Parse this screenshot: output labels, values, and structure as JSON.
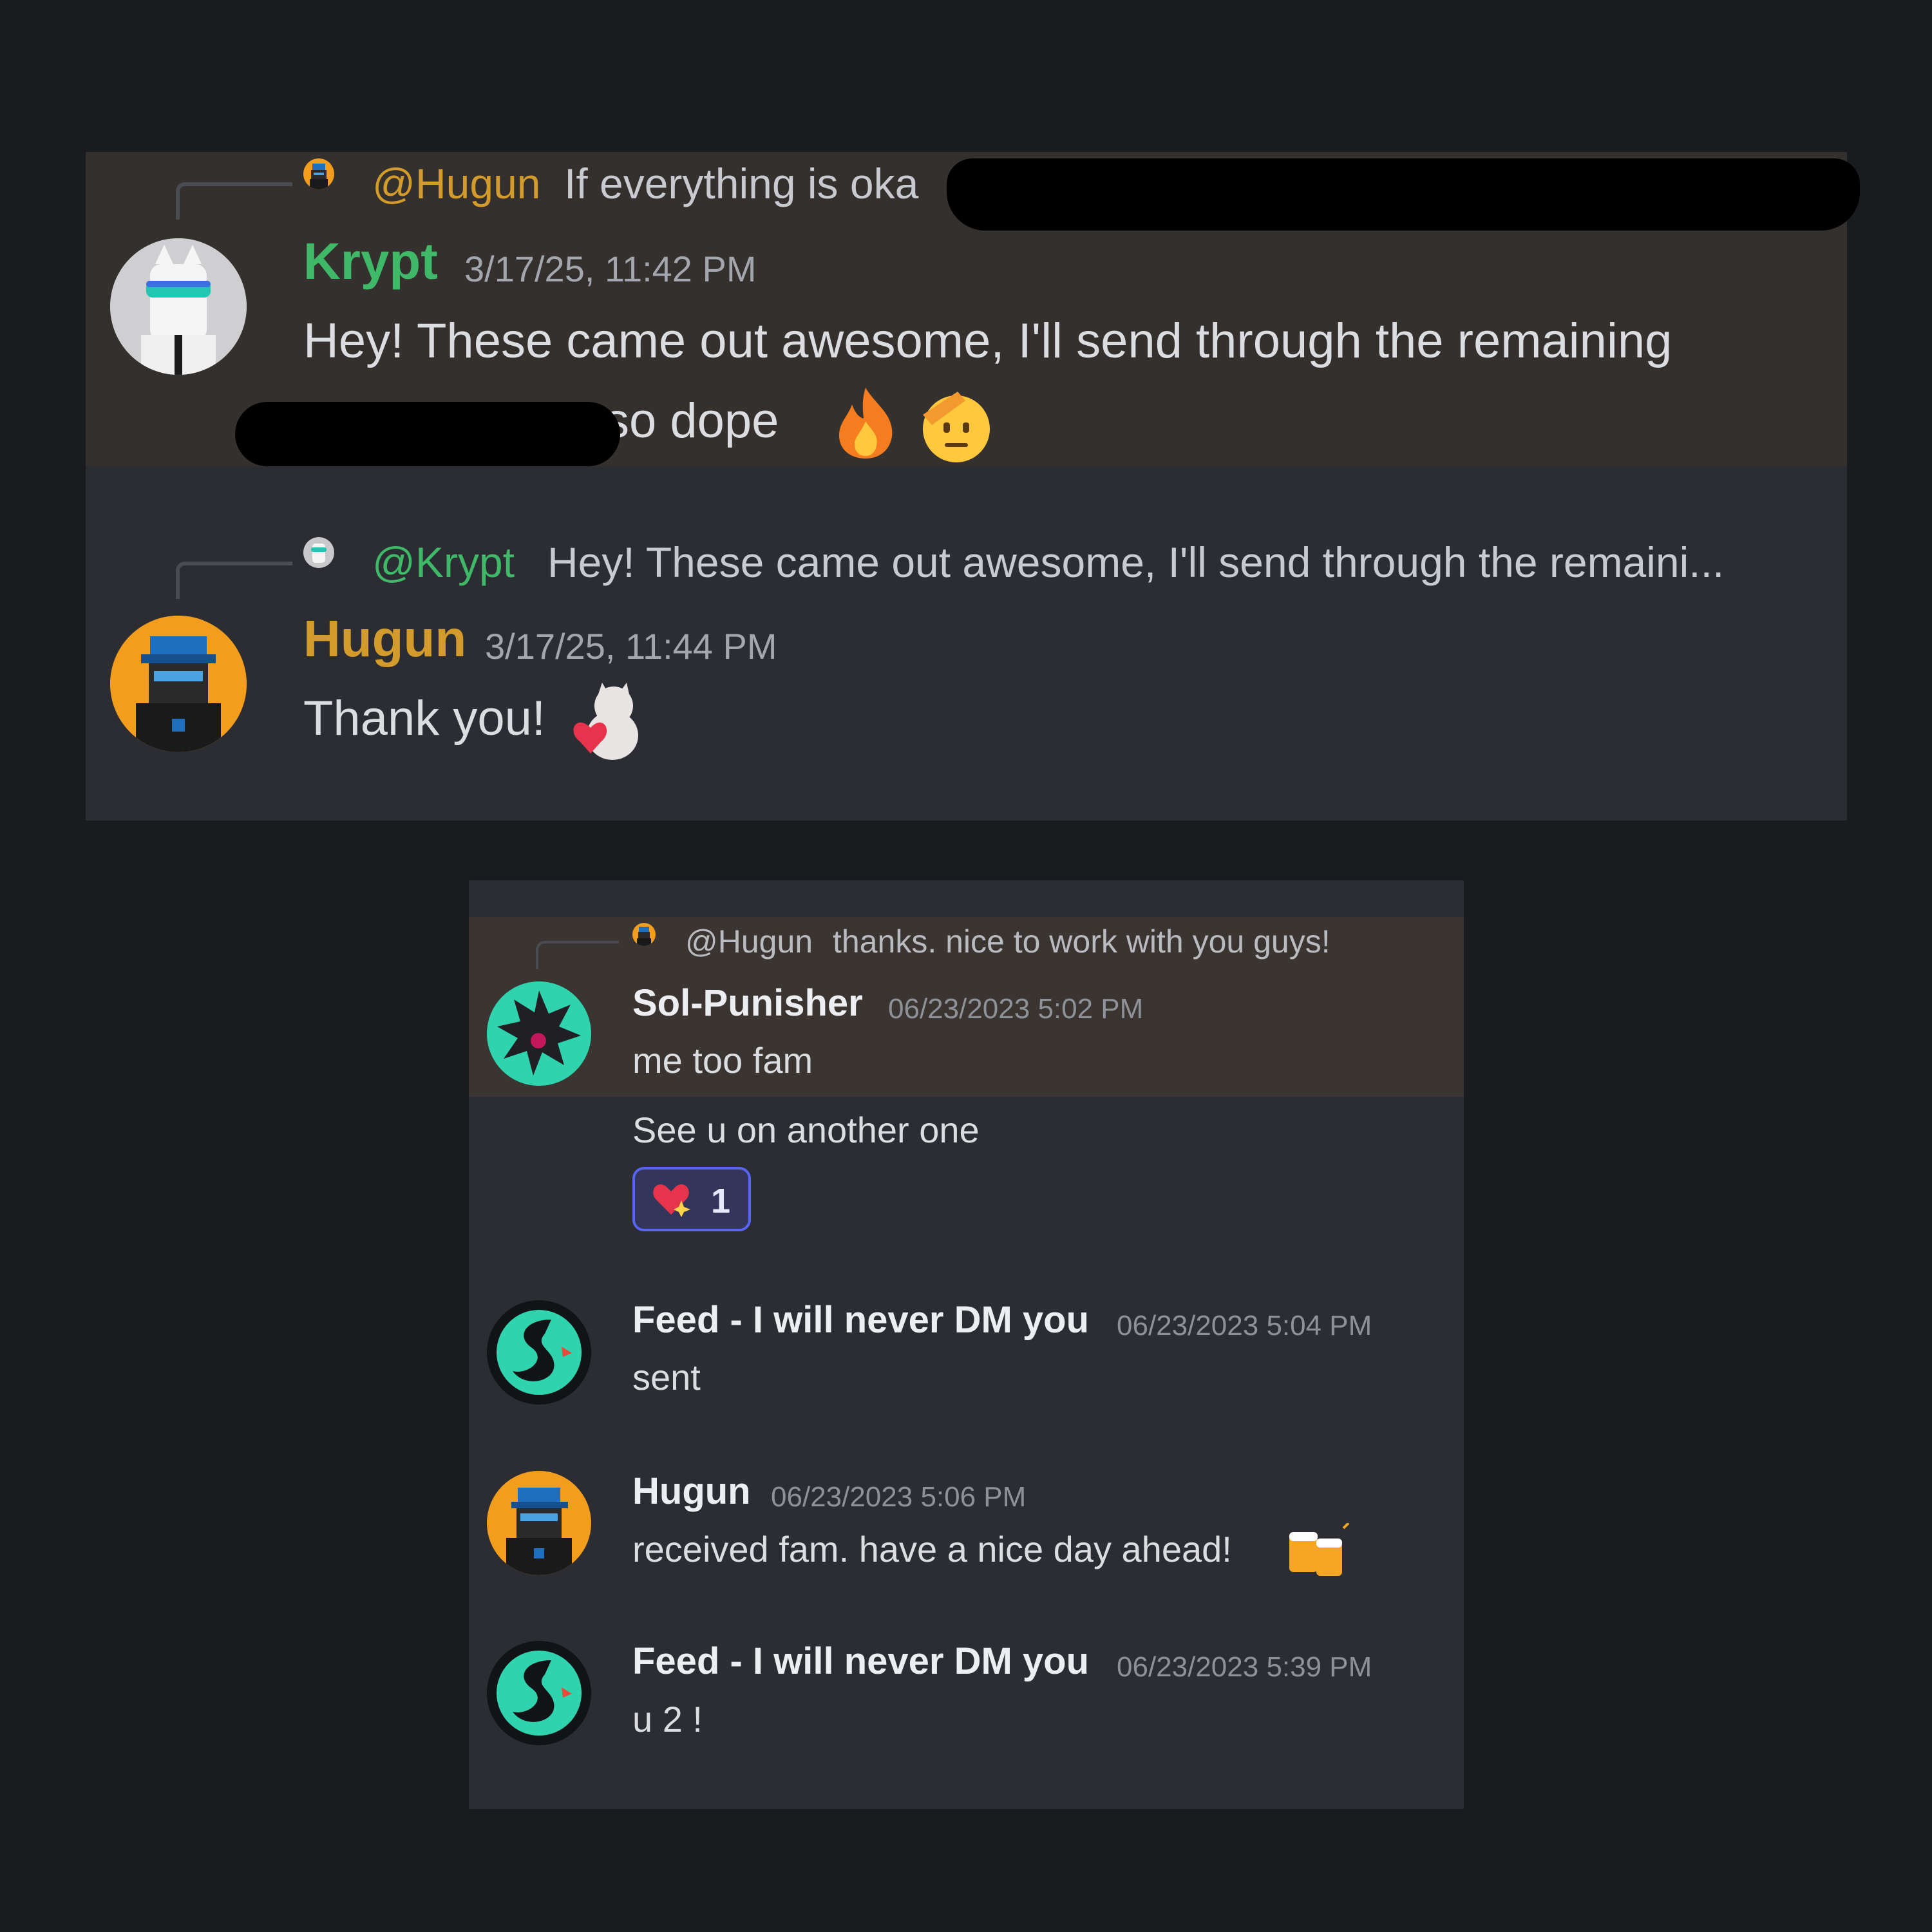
{
  "colors": {
    "background": "#1a1b1e",
    "panel": "#2c2d33",
    "highlight": "#34302e",
    "krypt_green": "#3fb968",
    "hugun_gold": "#d39b2c",
    "text": "#dcdde0",
    "muted": "#a3a6ad",
    "reaction_border": "#5865f2"
  },
  "top": {
    "messages": [
      {
        "reply": {
          "mention": "@Hugun",
          "text": "If everything is oka",
          "tail": "..."
        },
        "author": "Krypt",
        "timestamp": "3/17/25, 11:42 PM",
        "line1": "Hey! These came out awesome, I'll send through the remaining",
        "line2": "so dope",
        "emojis": [
          "fire-emoji",
          "saluting-face-emoji"
        ]
      },
      {
        "reply": {
          "mention": "@Krypt",
          "text": "Hey! These came out awesome, I'll send through the remaini..."
        },
        "author": "Hugun",
        "timestamp": "3/17/25, 11:44 PM",
        "text": "Thank you!",
        "emojis": [
          "cat-heart-sticker"
        ]
      }
    ]
  },
  "bottom": {
    "messages": [
      {
        "reply": {
          "mention": "@Hugun",
          "text": "thanks. nice to work with you guys!"
        },
        "author": "Sol-Punisher",
        "timestamp": "06/23/2023 5:02 PM",
        "text": "me too fam",
        "followup": "See u on another one",
        "reaction": {
          "emoji": "sparkling-heart-emoji",
          "count": "1"
        }
      },
      {
        "author": "Feed - I will never DM you",
        "timestamp": "06/23/2023 5:04 PM",
        "text": "sent"
      },
      {
        "author": "Hugun",
        "timestamp": "06/23/2023 5:06 PM",
        "text": "received fam. have a nice day ahead!",
        "emojis": [
          "clinking-beer-mugs-emoji"
        ]
      },
      {
        "author": "Feed - I will never DM you",
        "timestamp": "06/23/2023 5:39 PM",
        "text": "u 2 !"
      }
    ]
  }
}
